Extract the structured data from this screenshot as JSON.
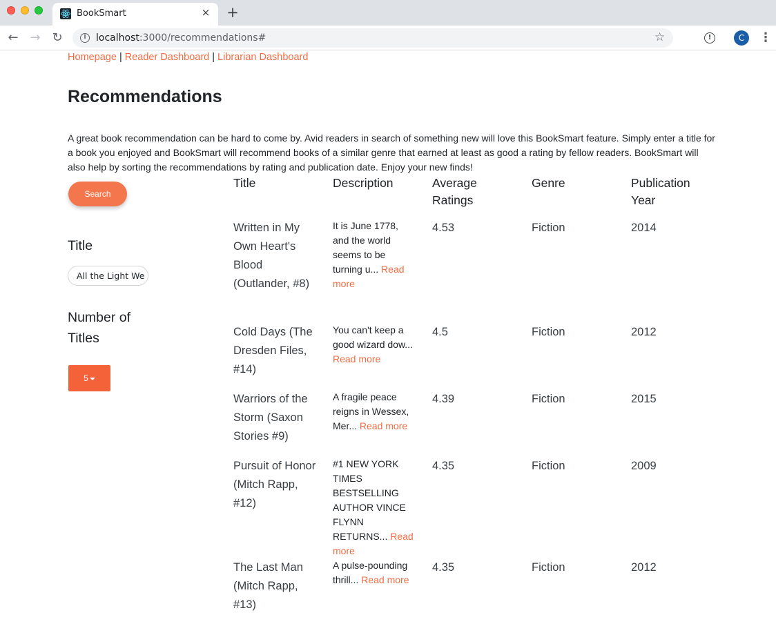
{
  "browser": {
    "tab_title": "BookSmart",
    "tab_close": "×",
    "new_tab": "+",
    "url_host": "localhost",
    "url_path": ":3000/recommendations#",
    "back_icon": "←",
    "forward_icon": "→",
    "reload_icon": "↻",
    "star_icon": "☆",
    "avatar_letter": "C",
    "menu_icon": "⋮"
  },
  "nav": {
    "links": [
      "Homepage",
      "Reader Dashboard",
      "Librarian Dashboard"
    ],
    "separator": "|"
  },
  "page": {
    "title": "Recommendations",
    "intro": "A great book recommendation can be hard to come by. Avid readers in search of something new will love this BookSmart feature. Simply enter a title for a book you enjoyed and BookSmart will recommend books of a similar genre that earned at least as good a rating by fellow readers. BookSmart will also help by sorting the recommendations by rating and publication date. Enjoy your new finds!"
  },
  "sidebar": {
    "search_label": "Search",
    "title_label": "Title",
    "title_value": "All the Light We Cannot See",
    "count_label": "Number of Titles",
    "count_value": "5"
  },
  "table": {
    "headers": [
      "Title",
      "Description",
      "Average Ratings",
      "Genre",
      "Publication Year"
    ],
    "read_more": "Read more",
    "rows": [
      {
        "title": "Written in My Own Heart's Blood (Outlander, #8)",
        "description": "It is June 1778, and the world seems to be turning u...",
        "rating": "4.53",
        "genre": "Fiction",
        "year": "2014"
      },
      {
        "title": "Cold Days (The Dresden Files, #14)",
        "description": "You can't keep a good wizard dow...",
        "rating": "4.5",
        "genre": "Fiction",
        "year": "2012"
      },
      {
        "title": "Warriors of the Storm (Saxon Stories #9)",
        "description": "A fragile peace reigns in Wessex, Mer...",
        "rating": "4.39",
        "genre": "Fiction",
        "year": "2015"
      },
      {
        "title": "Pursuit of Honor (Mitch Rapp, #12)",
        "description": "#1 NEW YORK TIMES BESTSELLING AUTHOR VINCE FLYNN RETURNS...",
        "rating": "4.35",
        "genre": "Fiction",
        "year": "2009"
      },
      {
        "title": "The Last Man (Mitch Rapp, #13)",
        "description": "A pulse-pounding thrill...",
        "rating": "4.35",
        "genre": "Fiction",
        "year": "2012"
      }
    ]
  }
}
